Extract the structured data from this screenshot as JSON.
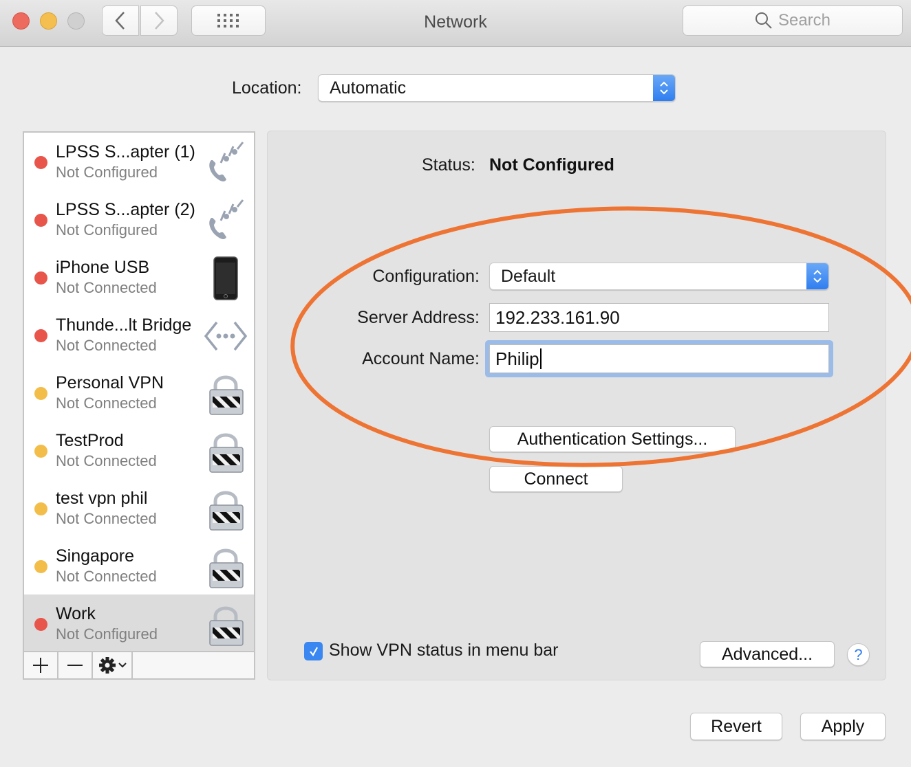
{
  "window": {
    "title": "Network",
    "search_placeholder": "Search"
  },
  "location": {
    "label": "Location:",
    "value": "Automatic"
  },
  "services": [
    {
      "name": "LPSS S...apter (1)",
      "status": "Not Configured",
      "status_color": "#e8554b",
      "icon": "modem-phone-icon"
    },
    {
      "name": "LPSS S...apter (2)",
      "status": "Not Configured",
      "status_color": "#e8554b",
      "icon": "modem-phone-icon"
    },
    {
      "name": "iPhone USB",
      "status": "Not Connected",
      "status_color": "#e8554b",
      "icon": "iphone-icon"
    },
    {
      "name": "Thunde...lt Bridge",
      "status": "Not Connected",
      "status_color": "#e8554b",
      "icon": "bridge-icon"
    },
    {
      "name": "Personal VPN",
      "status": "Not Connected",
      "status_color": "#f3bd4a",
      "icon": "vpn-lock-icon"
    },
    {
      "name": "TestProd",
      "status": "Not Connected",
      "status_color": "#f3bd4a",
      "icon": "vpn-lock-icon"
    },
    {
      "name": "test vpn phil",
      "status": "Not Connected",
      "status_color": "#f3bd4a",
      "icon": "vpn-lock-icon"
    },
    {
      "name": "Singapore",
      "status": "Not Connected",
      "status_color": "#f3bd4a",
      "icon": "vpn-lock-icon"
    },
    {
      "name": "Work",
      "status": "Not Configured",
      "status_color": "#e8554b",
      "icon": "vpn-lock-icon",
      "selected": true
    }
  ],
  "sidebar_toolbar": {
    "add": "+",
    "remove": "—"
  },
  "detail": {
    "status_label": "Status:",
    "status_value": "Not Configured",
    "configuration_label": "Configuration:",
    "configuration_value": "Default",
    "server_label": "Server Address:",
    "server_value": "192.233.161.90",
    "account_label": "Account Name:",
    "account_value": "Philip",
    "auth_button": "Authentication Settings...",
    "connect_button": "Connect",
    "show_vpn_label": "Show VPN status in menu bar",
    "show_vpn_checked": true,
    "advanced_button": "Advanced...",
    "help_button": "?"
  },
  "footer": {
    "revert": "Revert",
    "apply": "Apply"
  },
  "colors": {
    "accent": "#3b87f1",
    "annotation": "#ee7434",
    "status_red": "#e8554b",
    "status_yellow": "#f3bd4a"
  }
}
